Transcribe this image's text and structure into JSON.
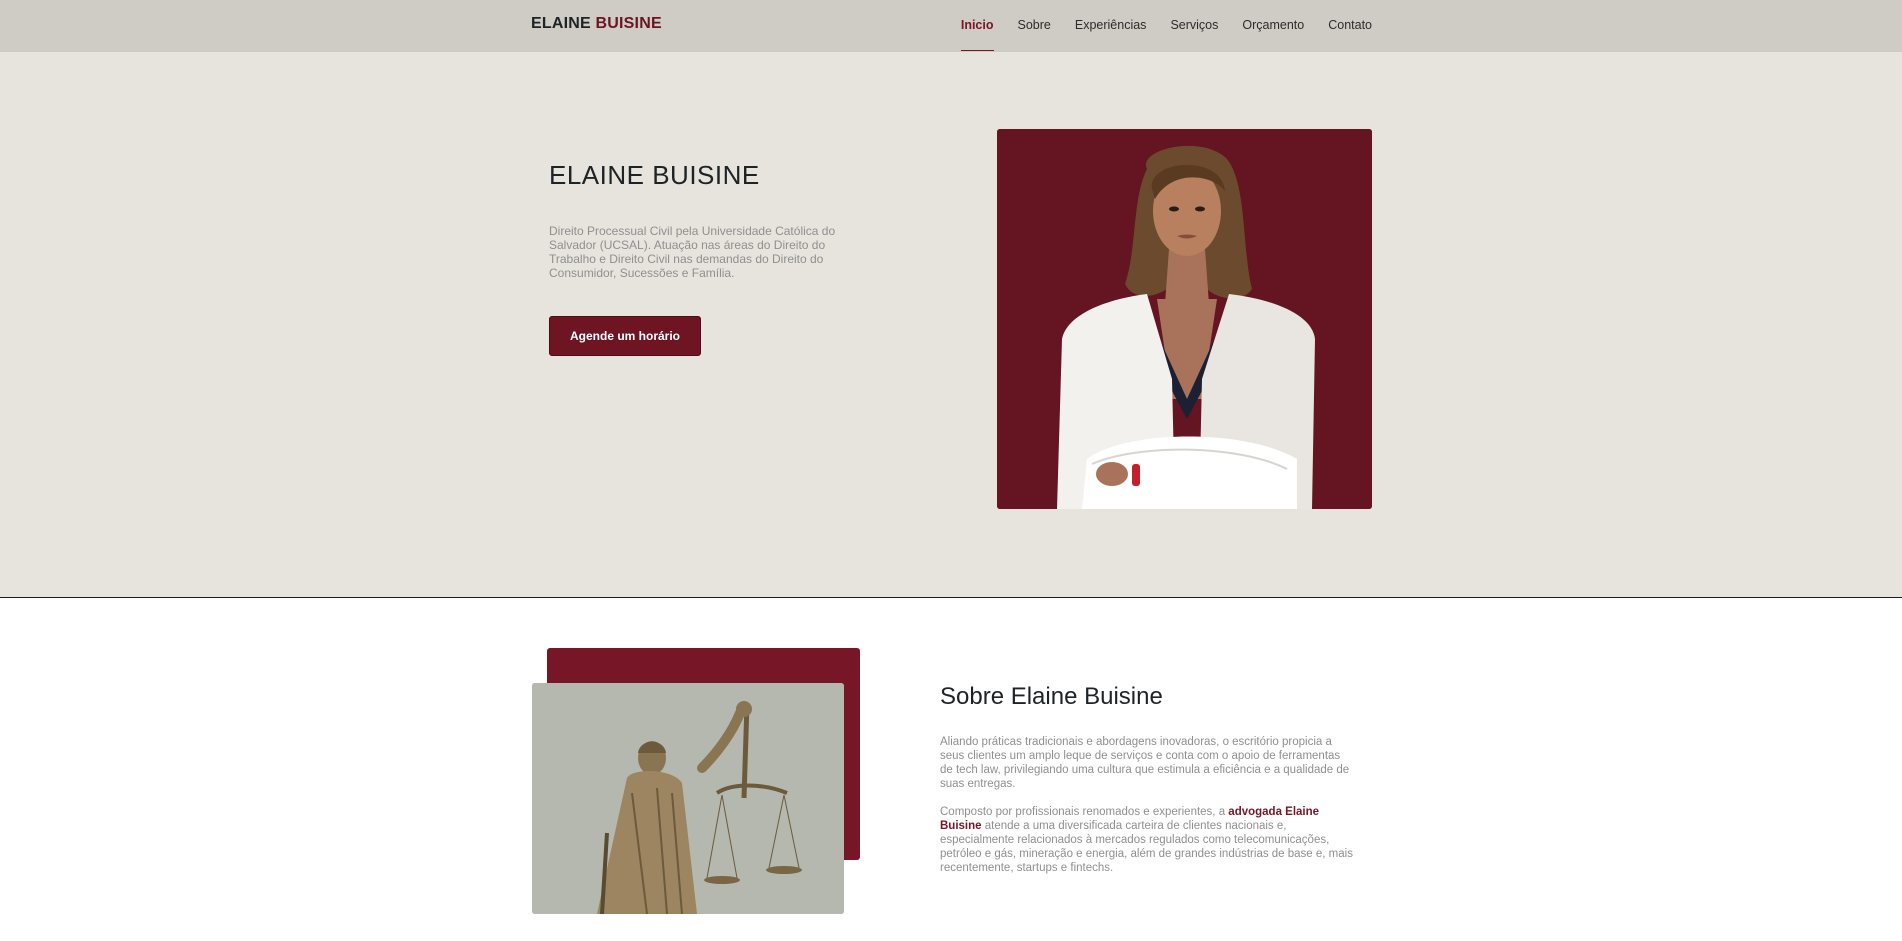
{
  "nav": {
    "logo_part1": "ELAINE",
    "logo_part2": "BUISINE",
    "links": [
      "Inicio",
      "Sobre",
      "Experiências",
      "Serviços",
      "Orçamento",
      "Contato"
    ],
    "active": "Inicio"
  },
  "hero": {
    "title": "ELAINE BUISINE",
    "description": "Direito Processual Civil pela Universidade Católica do Salvador (UCSAL). Atuação nas áreas do Direito do Trabalho e Direito Civil nas demandas do Direito do Consumidor, Sucessões e Família.",
    "cta_label": "Agende um horário"
  },
  "about": {
    "title": "Sobre Elaine Buisine",
    "paragraph1": "Aliando práticas tradicionais e abordagens inovadoras, o escritório propicia a seus clientes um amplo leque de serviços e conta com o apoio de ferramentas de tech law, privilegiando uma cultura que estimula a eficiência e a qualidade de suas entregas.",
    "paragraph2_prefix": "Composto por profissionais renomados e experientes, a ",
    "paragraph2_highlight": "advogada Elaine Buisine",
    "paragraph2_suffix": " atende a uma diversificada carteira de clientes nacionais e, especialmente relacionados à mercados regulados como telecomunicações, petróleo e gás, mineração e energia, além de grandes indústrias de base e, mais recentemente, startups e fintechs."
  },
  "colors": {
    "accent": "#6e1422",
    "navbar_bg": "#cfccc6",
    "hero_bg": "#e7e4dd",
    "muted_text": "#8f8f8f"
  }
}
